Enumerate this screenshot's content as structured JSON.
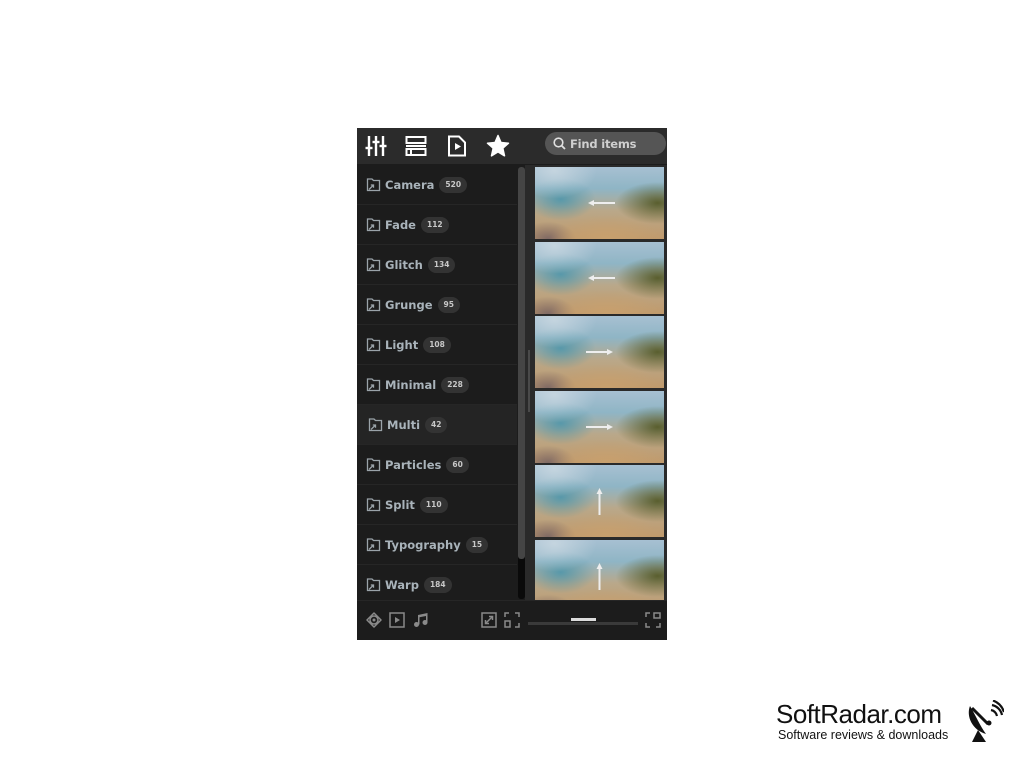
{
  "toolbar": {
    "tabs": [
      {
        "icon": "sliders-icon",
        "label": "Adjustments"
      },
      {
        "icon": "list-icon",
        "label": "List"
      },
      {
        "icon": "video-file-icon",
        "label": "Media"
      },
      {
        "icon": "star-icon",
        "label": "Favorites"
      }
    ],
    "search_placeholder": "Find items"
  },
  "categories": [
    {
      "label": "Camera",
      "count": "520"
    },
    {
      "label": "Fade",
      "count": "112"
    },
    {
      "label": "Glitch",
      "count": "134"
    },
    {
      "label": "Grunge",
      "count": "95"
    },
    {
      "label": "Light",
      "count": "108"
    },
    {
      "label": "Minimal",
      "count": "228"
    },
    {
      "label": "Multi",
      "count": "42",
      "active": true
    },
    {
      "label": "Particles",
      "count": "60"
    },
    {
      "label": "Split",
      "count": "110"
    },
    {
      "label": "Typography",
      "count": "15"
    },
    {
      "label": "Warp",
      "count": "184"
    }
  ],
  "thumbnails": [
    {
      "direction": "left"
    },
    {
      "direction": "left"
    },
    {
      "direction": "right"
    },
    {
      "direction": "right"
    },
    {
      "direction": "up"
    },
    {
      "direction": "up"
    }
  ],
  "bottombar": {
    "icons": [
      "target-icon",
      "play-icon",
      "music-note-icon",
      "expand-icon",
      "fit-icon",
      "fullscreen-icon"
    ],
    "zoom_slider_value": 0.5
  },
  "watermark": {
    "title": "SoftRadar.com",
    "subtitle": "Software reviews & downloads"
  }
}
